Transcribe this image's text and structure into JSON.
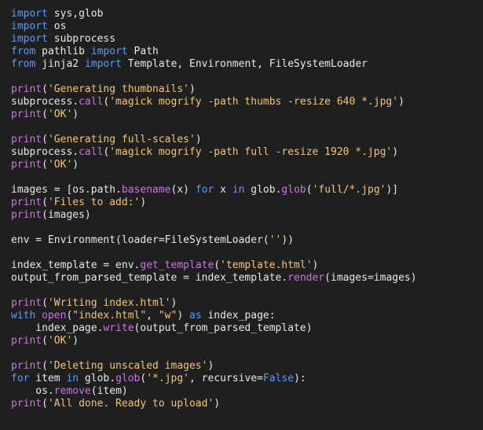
{
  "editor": {
    "lines": [
      [
        [
          "kw",
          "import"
        ],
        [
          "txt",
          " sys,glob"
        ]
      ],
      [
        [
          "kw",
          "import"
        ],
        [
          "txt",
          " os"
        ]
      ],
      [
        [
          "kw",
          "import"
        ],
        [
          "txt",
          " subprocess"
        ]
      ],
      [
        [
          "kw",
          "from"
        ],
        [
          "txt",
          " pathlib "
        ],
        [
          "kw",
          "import"
        ],
        [
          "txt",
          " Path"
        ]
      ],
      [
        [
          "kw",
          "from"
        ],
        [
          "txt",
          " jinja2 "
        ],
        [
          "kw",
          "import"
        ],
        [
          "txt",
          " Template, Environment, FileSystemLoader"
        ]
      ],
      [],
      [
        [
          "fn",
          "print"
        ],
        [
          "txt",
          "("
        ],
        [
          "str",
          "'Generating thumbnails'"
        ],
        [
          "txt",
          ")"
        ]
      ],
      [
        [
          "txt",
          "subprocess."
        ],
        [
          "fn",
          "call"
        ],
        [
          "txt",
          "("
        ],
        [
          "str",
          "'magick mogrify -path thumbs -resize 640 *.jpg'"
        ],
        [
          "txt",
          ")"
        ]
      ],
      [
        [
          "fn",
          "print"
        ],
        [
          "txt",
          "("
        ],
        [
          "str",
          "'OK'"
        ],
        [
          "txt",
          ")"
        ]
      ],
      [],
      [
        [
          "fn",
          "print"
        ],
        [
          "txt",
          "("
        ],
        [
          "str",
          "'Generating full-scales'"
        ],
        [
          "txt",
          ")"
        ]
      ],
      [
        [
          "txt",
          "subprocess."
        ],
        [
          "fn",
          "call"
        ],
        [
          "txt",
          "("
        ],
        [
          "str",
          "'magick mogrify -path full -resize 1920 *.jpg'"
        ],
        [
          "txt",
          ")"
        ]
      ],
      [
        [
          "fn",
          "print"
        ],
        [
          "txt",
          "("
        ],
        [
          "str",
          "'OK'"
        ],
        [
          "txt",
          ")"
        ]
      ],
      [],
      [
        [
          "txt",
          "images = [os.path."
        ],
        [
          "fn",
          "basename"
        ],
        [
          "txt",
          "(x) "
        ],
        [
          "kw",
          "for"
        ],
        [
          "txt",
          " x "
        ],
        [
          "kw",
          "in"
        ],
        [
          "txt",
          " glob."
        ],
        [
          "fn",
          "glob"
        ],
        [
          "txt",
          "("
        ],
        [
          "str",
          "'full/*.jpg'"
        ],
        [
          "txt",
          ")]"
        ]
      ],
      [
        [
          "fn",
          "print"
        ],
        [
          "txt",
          "("
        ],
        [
          "str",
          "'Files to add:'"
        ],
        [
          "txt",
          ")"
        ]
      ],
      [
        [
          "fn",
          "print"
        ],
        [
          "txt",
          "(images)"
        ]
      ],
      [],
      [
        [
          "txt",
          "env = Environment(loader=FileSystemLoader("
        ],
        [
          "str",
          "''"
        ],
        [
          "txt",
          "))"
        ]
      ],
      [],
      [
        [
          "txt",
          "index_template = env."
        ],
        [
          "fn",
          "get_template"
        ],
        [
          "txt",
          "("
        ],
        [
          "str",
          "'template.html'"
        ],
        [
          "txt",
          ")"
        ]
      ],
      [
        [
          "txt",
          "output_from_parsed_template = index_template."
        ],
        [
          "fn",
          "render"
        ],
        [
          "txt",
          "(images=images)"
        ]
      ],
      [],
      [
        [
          "fn",
          "print"
        ],
        [
          "txt",
          "("
        ],
        [
          "str",
          "'Writing index.html'"
        ],
        [
          "txt",
          ")"
        ]
      ],
      [
        [
          "kw",
          "with"
        ],
        [
          "txt",
          " "
        ],
        [
          "fn",
          "open"
        ],
        [
          "txt",
          "("
        ],
        [
          "str",
          "\"index.html\""
        ],
        [
          "txt",
          ", "
        ],
        [
          "str",
          "\"w\""
        ],
        [
          "txt",
          ") "
        ],
        [
          "kw",
          "as"
        ],
        [
          "txt",
          " index_page:"
        ]
      ],
      [
        [
          "txt",
          "    index_page."
        ],
        [
          "fn",
          "write"
        ],
        [
          "txt",
          "(output_from_parsed_template)"
        ]
      ],
      [
        [
          "fn",
          "print"
        ],
        [
          "txt",
          "("
        ],
        [
          "str",
          "'OK'"
        ],
        [
          "txt",
          ")"
        ]
      ],
      [],
      [
        [
          "fn",
          "print"
        ],
        [
          "txt",
          "("
        ],
        [
          "str",
          "'Deleting unscaled images'"
        ],
        [
          "txt",
          ")"
        ]
      ],
      [
        [
          "kw",
          "for"
        ],
        [
          "txt",
          " item "
        ],
        [
          "kw",
          "in"
        ],
        [
          "txt",
          " glob."
        ],
        [
          "fn",
          "glob"
        ],
        [
          "txt",
          "("
        ],
        [
          "str",
          "'*.jpg'"
        ],
        [
          "txt",
          ", recursive="
        ],
        [
          "bool",
          "False"
        ],
        [
          "txt",
          "):"
        ]
      ],
      [
        [
          "txt",
          "    os."
        ],
        [
          "fn",
          "remove"
        ],
        [
          "txt",
          "(item)"
        ]
      ],
      [
        [
          "fn",
          "print"
        ],
        [
          "txt",
          "("
        ],
        [
          "str",
          "'All done. Ready to upload'"
        ],
        [
          "txt",
          ")"
        ]
      ]
    ]
  },
  "colors": {
    "background": "#1f1f1f",
    "keyword": "#5c9cf5",
    "function": "#c678dd",
    "string": "#f0c674",
    "text": "#e8e8e8"
  }
}
